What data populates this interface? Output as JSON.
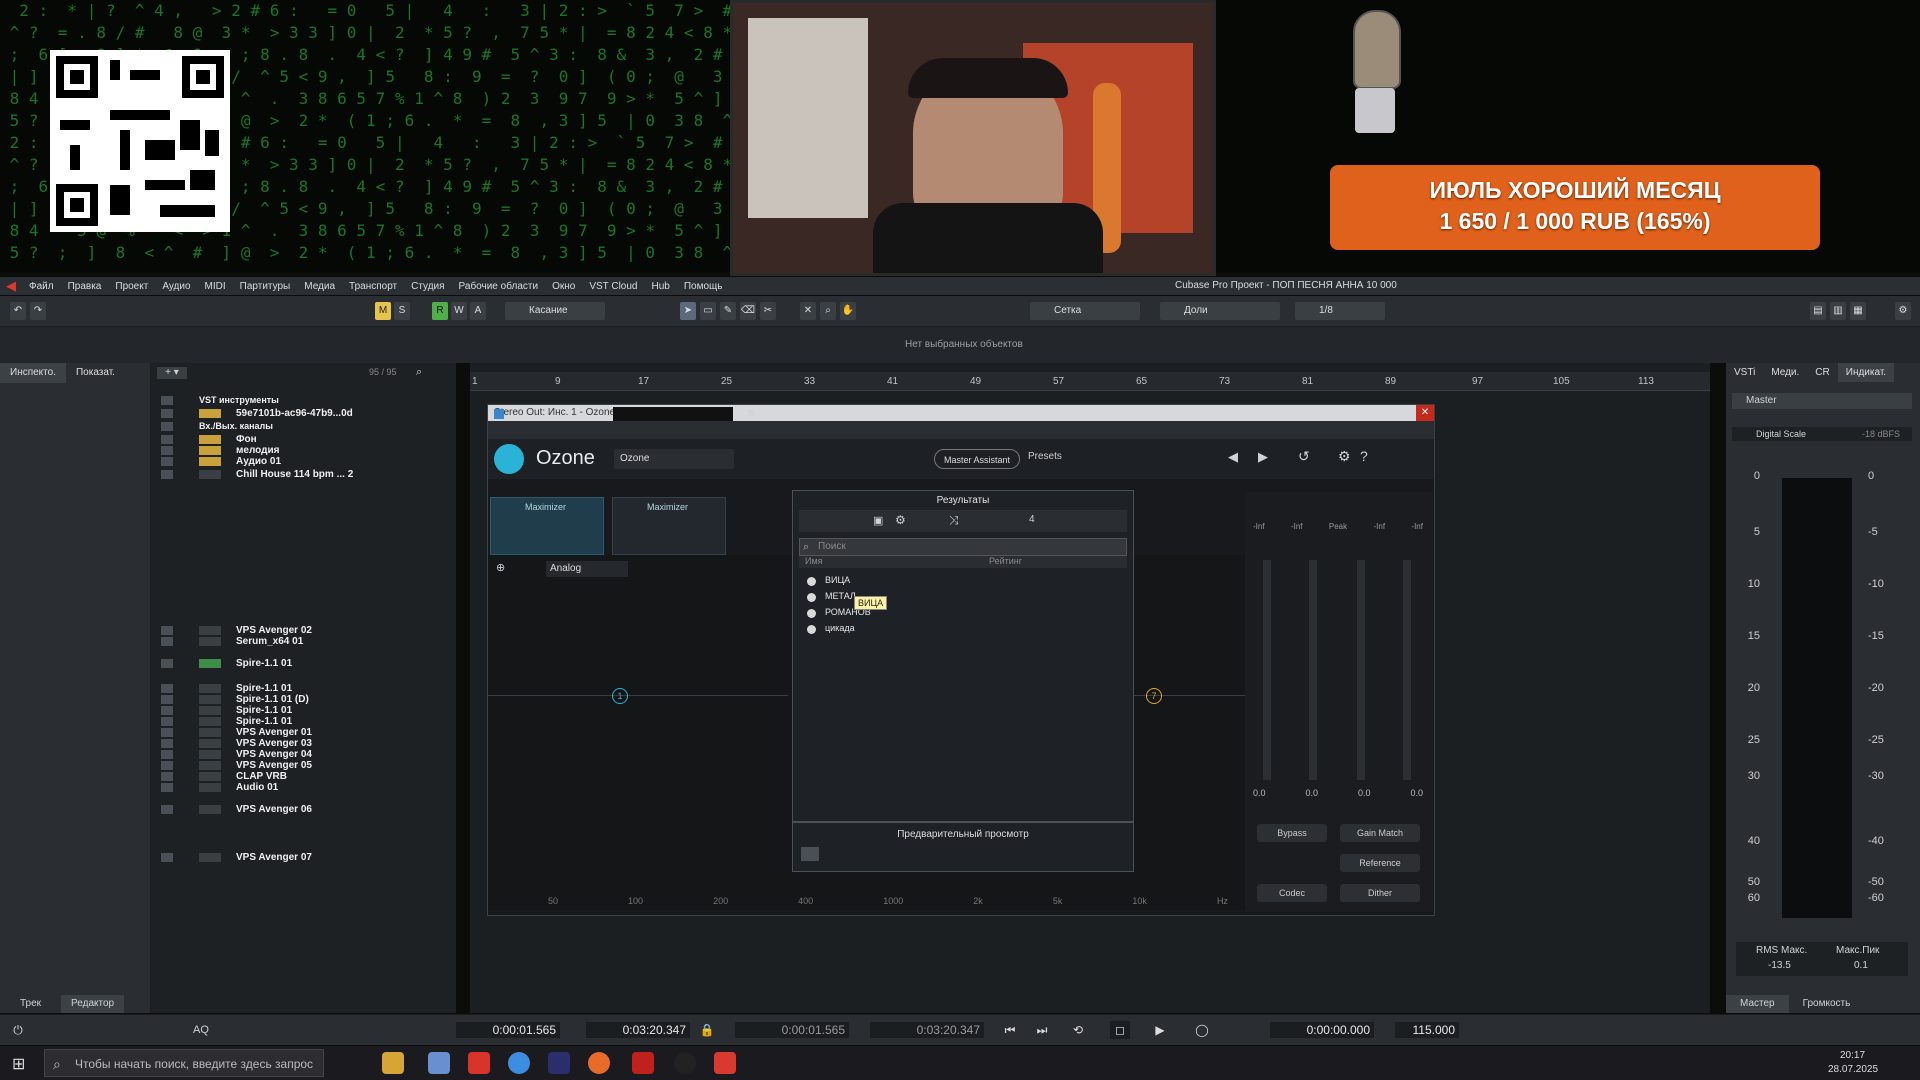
{
  "overlay": {
    "donation_line1": "ИЮЛЬ ХОРОШИЙ МЕСЯЦ",
    "donation_line2": "1 650 / 1 000 RUB (165%)"
  },
  "app": {
    "title": "Cubase Pro Проект - ПОП ПЕСНЯ АННА 10 000",
    "menu": [
      "Файл",
      "Правка",
      "Проект",
      "Аудио",
      "MIDI",
      "Партитуры",
      "Медиа",
      "Транспорт",
      "Студия",
      "Рабочие области",
      "Окно",
      "VST Cloud",
      "Hub",
      "Помощь"
    ],
    "status": "Нет выбранных объектов"
  },
  "toolbar": {
    "mode_label": "Касание",
    "grid_label": "Сетка",
    "bars_label": "Доли",
    "quantize": "1/8"
  },
  "inspector": {
    "tabs": [
      "Инспекто.",
      "Показат."
    ],
    "bottom_tabs": [
      "Трек",
      "Редактор"
    ]
  },
  "tracklist": {
    "count": "95 / 95",
    "tracks": [
      "VST инструменты",
      "59e7101b-ac96-47b9...0d",
      "Вх./Вых. каналы",
      "Фон",
      "мелодия",
      "Аудио 01",
      "Chill House 114 bpm ... 2",
      "VPS Avenger 02",
      "Serum_x64 01",
      "Spire-1.1 01",
      "Spire-1.1 01",
      "Spire-1.1 01 (D)",
      "Spire-1.1 01",
      "Spire-1.1 01",
      "VPS Avenger 01",
      "VPS Avenger 03",
      "VPS Avenger 04",
      "VPS Avenger 05",
      "CLAP VRB",
      "Audio 01",
      "VPS Avenger 06",
      "VPS Avenger 07"
    ]
  },
  "ruler": [
    "1",
    "9",
    "17",
    "25",
    "33",
    "41",
    "49",
    "57",
    "65",
    "73",
    "81",
    "89",
    "97",
    "105",
    "113"
  ],
  "ozone": {
    "window_title": "Stereo Out: Инс. 1 - Ozone 9",
    "name": "Ozone",
    "preset_name": "Ozone",
    "master_button": "Master Assistant",
    "presets_label": "Presets",
    "modules": [
      "Maximizer",
      "Maximizer"
    ],
    "eq_mode": "Analog",
    "meter_labels": [
      "-Inf",
      "-Inf",
      "Peak",
      "-Inf",
      "-Inf"
    ],
    "meter_values": [
      "0.0",
      "0.0",
      "0.0",
      "0.0"
    ],
    "buttons": [
      "Bypass",
      "Gain Match",
      "Reference",
      "Codec",
      "Dither"
    ],
    "freq_ticks": [
      "50",
      "100",
      "200",
      "400",
      "1000",
      "2k",
      "5k",
      "10k",
      "Hz"
    ]
  },
  "presets_popup": {
    "title": "Результаты",
    "search_placeholder": "Поиск",
    "col_name": "Имя",
    "col_rating": "Рейтинг",
    "items": [
      "ВИЦА",
      "МЕТАЛ",
      "РОМАНОВ",
      "цикада"
    ],
    "tooltip": "ВИЦА",
    "count": "4",
    "preview_label": "Предварительный просмотр"
  },
  "right_panel": {
    "tabs": [
      "VSTi",
      "Меди.",
      "CR",
      "Индикат."
    ],
    "master": "Master",
    "scale_label": "Digital Scale",
    "scale_value": "-18 dBFS",
    "scale_left": [
      "0",
      "5",
      "10",
      "15",
      "20",
      "25",
      "30",
      "40",
      "50",
      "60"
    ],
    "scale_right": [
      "0",
      "-5",
      "-10",
      "-15",
      "-20",
      "-25",
      "-30",
      "-40",
      "-50",
      "-60"
    ],
    "rms_label": "RMS Макс.",
    "rms_value": "-13.5",
    "peak_label": "Макс.Пик",
    "peak_value": "0.1",
    "bottom_tabs": [
      "Мастер",
      "Громкость"
    ]
  },
  "transport": {
    "left_locator": "0:00:01.565",
    "right_locator": "0:03:20.347",
    "punch_in": "0:00:01.565",
    "punch_out": "0:03:20.347",
    "position": "0:00:00.000",
    "tempo": "115.000",
    "aq": "AQ"
  },
  "taskbar": {
    "search_placeholder": "Чтобы начать поиск, введите здесь запрос",
    "time": "20:17",
    "date": "28.07.2025"
  }
}
